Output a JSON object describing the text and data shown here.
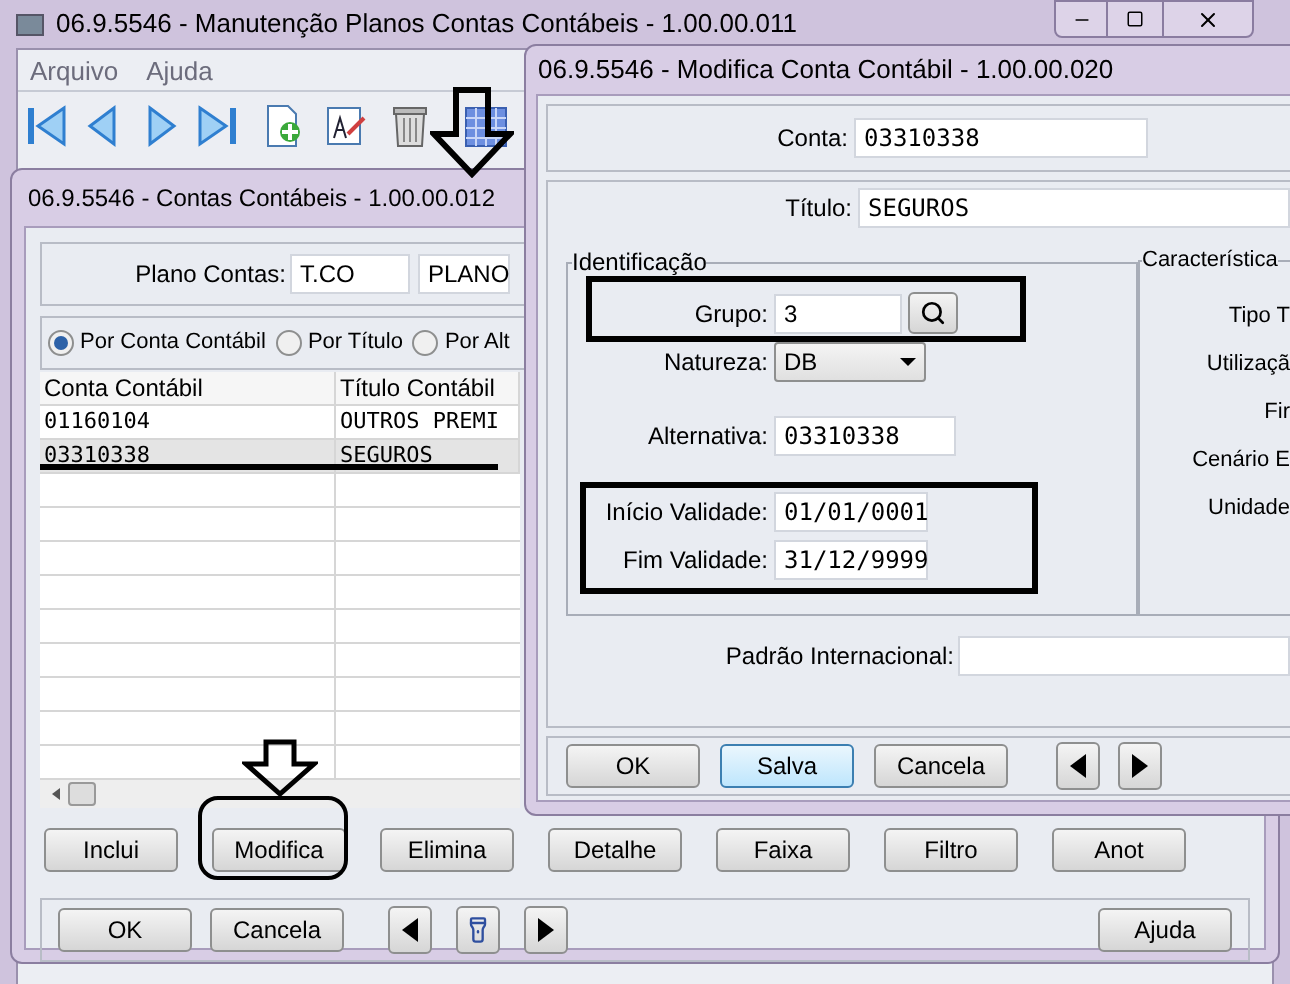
{
  "main_window": {
    "title": "06.9.5546 - Manutenção Planos Contas Contábeis - 1.00.00.011",
    "menu": [
      "Arquivo",
      "Ajuda"
    ]
  },
  "list_window": {
    "title": "06.9.5546 - Contas Contábeis - 1.00.00.012",
    "plano_contas": {
      "label": "Plano Contas:",
      "code": "T.CO",
      "name": "PLANO"
    },
    "sort_options": [
      {
        "label": "Por Conta Contábil",
        "selected": true
      },
      {
        "label": "Por Título",
        "selected": false
      },
      {
        "label": "Por Alt",
        "selected": false
      }
    ],
    "table": {
      "columns": [
        "Conta Contábil",
        "Título Contábil"
      ],
      "rows": [
        {
          "cells": [
            "01160104",
            "OUTROS PREMI"
          ],
          "selected": false
        },
        {
          "cells": [
            "03310338",
            "SEGUROS"
          ],
          "selected": true
        }
      ]
    },
    "actions": [
      "Inclui",
      "Modifica",
      "Elimina",
      "Detalhe",
      "Faixa",
      "Filtro",
      "Anot"
    ],
    "footer_buttons": [
      "OK",
      "Cancela"
    ],
    "help_button": "Ajuda"
  },
  "edit_window": {
    "title": "06.9.5546 - Modifica Conta Contábil - 1.00.00.020",
    "conta": {
      "label": "Conta:",
      "value": "03310338"
    },
    "titulo": {
      "label": "Título:",
      "value": "SEGUROS"
    },
    "identificacao": {
      "title": "Identificação",
      "grupo": {
        "label": "Grupo:",
        "value": "3"
      },
      "natureza": {
        "label": "Natureza:",
        "value": "DB"
      },
      "alternativa": {
        "label": "Alternativa:",
        "value": "03310338"
      },
      "inicio": {
        "label": "Início Validade:",
        "value": "01/01/0001"
      },
      "fim": {
        "label": "Fim Validade:",
        "value": "31/12/9999"
      }
    },
    "caracteristicas": {
      "title": "Característica",
      "labels": [
        "Tipo T",
        "Utilizaçã",
        "Fir",
        "Cenário E",
        "Unidade"
      ]
    },
    "padrao": {
      "label": "Padrão Internacional:"
    },
    "buttons": [
      {
        "label": "OK",
        "focused": false
      },
      {
        "label": "Salva",
        "focused": true
      },
      {
        "label": "Cancela",
        "focused": false
      }
    ]
  }
}
